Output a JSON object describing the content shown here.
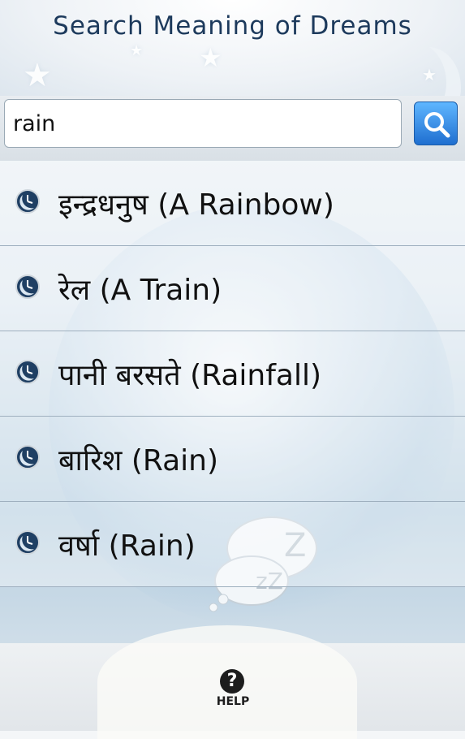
{
  "header": {
    "title": "Search Meaning of Dreams"
  },
  "search": {
    "value": "rain",
    "button_icon": "magnifier-icon"
  },
  "results": [
    {
      "label": "इन्द्रधनुष (A Rainbow)",
      "icon": "moon-clock-icon"
    },
    {
      "label": "रेल (A Train)",
      "icon": "moon-clock-icon"
    },
    {
      "label": "पानी बरसते (Rainfall)",
      "icon": "moon-clock-icon"
    },
    {
      "label": "बारिश (Rain)",
      "icon": "moon-clock-icon"
    },
    {
      "label": "वर्षा (Rain)",
      "icon": "moon-clock-icon"
    }
  ],
  "footer": {
    "help_label": "HELP",
    "help_glyph": "?"
  },
  "colors": {
    "title": "#1d3a5c",
    "accent": "#1f6fd0",
    "divider": "#9fb0bf"
  }
}
